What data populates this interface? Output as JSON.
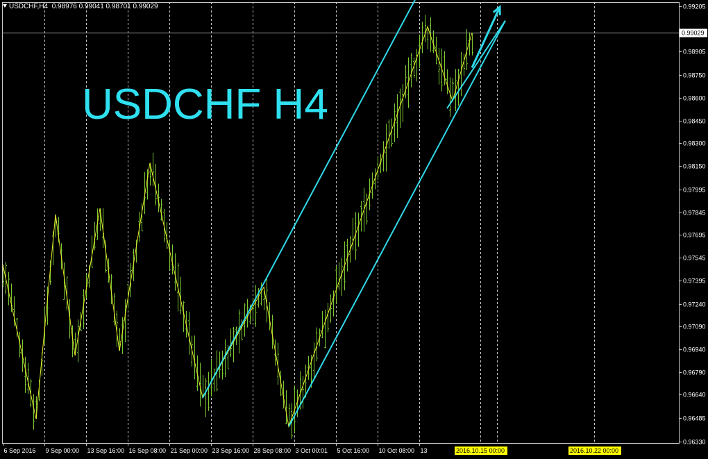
{
  "header": {
    "symbol_label": "USDCHF,H4",
    "ohlc_text": "0.98976 0.99041 0.98701 0.99029"
  },
  "overlay_title": "USDCHF H4",
  "colors": {
    "background": "#000000",
    "candles": "#7CC832",
    "zigzag": "#E8E82A",
    "channel": "#2FD9E8",
    "grid": "#C8C8C8",
    "axis_text": "#FFFFFF",
    "date_marker_bg": "#FFFF00"
  },
  "chart_data": {
    "type": "line",
    "title": "USDCHF H4",
    "ylim": [
      0.9633,
      0.99205
    ],
    "y_ticks": [
      "0.99205",
      "0.99029",
      "0.98905",
      "0.98750",
      "0.98600",
      "0.98450",
      "0.98300",
      "0.98150",
      "0.97995",
      "0.97845",
      "0.97695",
      "0.97545",
      "0.97395",
      "0.97240",
      "0.97090",
      "0.96940",
      "0.96790",
      "0.96640",
      "0.96485",
      "0.96330"
    ],
    "current_price": "0.99029",
    "x_ticks": [
      "6 Sep 2016",
      "9 Sep 00:00",
      "13 Sep 16:00",
      "16 Sep 08:00",
      "21 Sep 00:00",
      "23 Sep 16:00",
      "28 Sep 08:00",
      "3 Oct 00:01",
      "5 Oct 16:00",
      "10 Oct 08:00",
      "13"
    ],
    "date_markers": [
      "2016.10.15 00:00",
      "2016.10.22 00:00"
    ],
    "zigzag": [
      {
        "bar": 0,
        "y": 0.975
      },
      {
        "bar": 12,
        "y": 0.9648
      },
      {
        "bar": 19,
        "y": 0.9783
      },
      {
        "bar": 26,
        "y": 0.969
      },
      {
        "bar": 35,
        "y": 0.9787
      },
      {
        "bar": 42,
        "y": 0.9693
      },
      {
        "bar": 53,
        "y": 0.9817
      },
      {
        "bar": 72,
        "y": 0.9662
      },
      {
        "bar": 94,
        "y": 0.9735
      },
      {
        "bar": 103,
        "y": 0.9643
      },
      {
        "bar": 153,
        "y": 0.9907
      },
      {
        "bar": 162,
        "y": 0.9858
      },
      {
        "bar": 169,
        "y": 0.9903
      }
    ],
    "channel_lines": [
      {
        "from": {
          "bar": 72,
          "y": 0.9662
        },
        "to": {
          "bar": 150,
          "y": 0.993
        }
      },
      {
        "from": {
          "bar": 103,
          "y": 0.9643
        },
        "to": {
          "bar": 181,
          "y": 0.9911
        }
      },
      {
        "from": {
          "bar": 160,
          "y": 0.9853
        },
        "to": {
          "bar": 181,
          "y": 0.9911
        }
      }
    ],
    "forecast_arrow": {
      "from": {
        "bar": 169,
        "y": 0.988
      },
      "to": {
        "bar": 179,
        "y": 0.992
      }
    },
    "bars_count": 170,
    "bars_per_date_step": 15,
    "grid": true
  }
}
